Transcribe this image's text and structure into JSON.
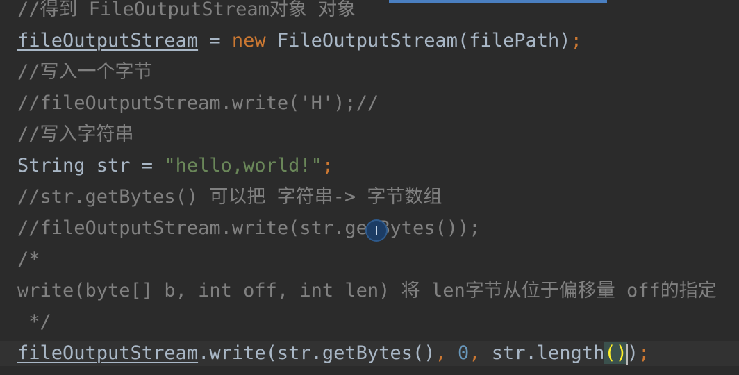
{
  "editor": {
    "lines": [
      {
        "tokens": [
          {
            "t": "//得到 FileOutputStream对象 对象",
            "c": "comment"
          }
        ]
      },
      {
        "tokens": [
          {
            "t": "fileOutputStream",
            "c": "field"
          },
          {
            "t": " = ",
            "c": "punct"
          },
          {
            "t": "new",
            "c": "keyword"
          },
          {
            "t": " FileOutputStream(filePath)",
            "c": "ident"
          },
          {
            "t": ";",
            "c": "semi"
          }
        ]
      },
      {
        "tokens": [
          {
            "t": "//写入一个字节",
            "c": "comment"
          }
        ]
      },
      {
        "tokens": [
          {
            "t": "//fileOutputStream.write('H');//",
            "c": "comment"
          }
        ]
      },
      {
        "tokens": [
          {
            "t": "//写入字符串",
            "c": "comment"
          }
        ]
      },
      {
        "tokens": [
          {
            "t": "String str = ",
            "c": "ident"
          },
          {
            "t": "\"hello,world!\"",
            "c": "string"
          },
          {
            "t": ";",
            "c": "semi"
          }
        ]
      },
      {
        "tokens": [
          {
            "t": "//str.getBytes() 可以把 字符串-> 字节数组",
            "c": "comment"
          }
        ]
      },
      {
        "tokens": [
          {
            "t": "//fileOutputStream.write(str.getBytes());",
            "c": "comment"
          }
        ]
      },
      {
        "tokens": [
          {
            "t": "/*",
            "c": "comment"
          }
        ]
      },
      {
        "tokens": [
          {
            "t": "write(byte[] b, int off, int len) 将 len字节从位于偏移量 off的指定",
            "c": "comment"
          }
        ]
      },
      {
        "tokens": [
          {
            "t": " */",
            "c": "comment"
          }
        ]
      },
      {
        "current": true,
        "tokens": [
          {
            "t": "fileOutputStream",
            "c": "field"
          },
          {
            "t": ".write(str.getBytes()",
            "c": "ident"
          },
          {
            "t": ", ",
            "c": "semi"
          },
          {
            "t": "0",
            "c": "number"
          },
          {
            "t": ", ",
            "c": "semi"
          },
          {
            "t": "str.length",
            "c": "ident"
          },
          {
            "t": "()",
            "c": "bracket-match"
          },
          {
            "t": "|cursor|",
            "c": "cursor"
          },
          {
            "t": ")",
            "c": "ident"
          },
          {
            "t": ";",
            "c": "semi"
          }
        ]
      }
    ]
  },
  "colors": {
    "background": "#2b2b2b",
    "comment": "#808080",
    "identifier": "#a9b7c6",
    "keyword": "#cc7832",
    "string": "#6a8759",
    "number": "#6897bb",
    "bracket_match": "#ffef28"
  },
  "icons": {
    "mouse_pointer": "text-cursor-icon"
  }
}
